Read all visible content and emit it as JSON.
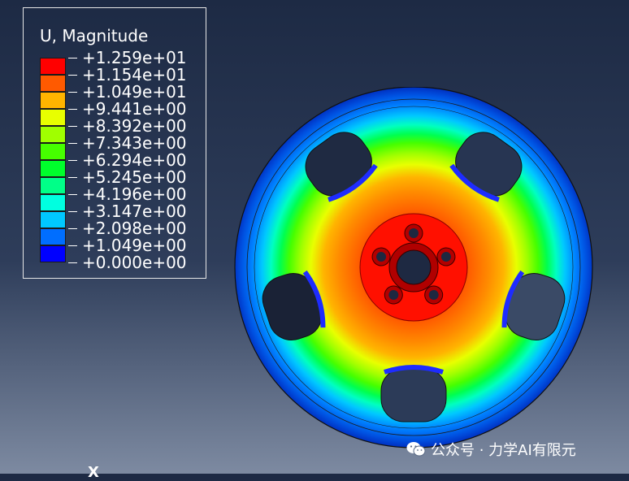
{
  "legend": {
    "title": "U, Magnitude",
    "entries": [
      {
        "label": "+1.259e+01",
        "color": "#ff0000"
      },
      {
        "label": "+1.154e+01",
        "color": "#ff5a00"
      },
      {
        "label": "+1.049e+01",
        "color": "#ffb400"
      },
      {
        "label": "+9.441e+00",
        "color": "#e8ff00"
      },
      {
        "label": "+8.392e+00",
        "color": "#a0ff00"
      },
      {
        "label": "+7.343e+00",
        "color": "#46ff00"
      },
      {
        "label": "+6.294e+00",
        "color": "#00ff2c"
      },
      {
        "label": "+5.245e+00",
        "color": "#00ff88"
      },
      {
        "label": "+4.196e+00",
        "color": "#00ffe0"
      },
      {
        "label": "+3.147e+00",
        "color": "#00c8ff"
      },
      {
        "label": "+2.098e+00",
        "color": "#006eff"
      },
      {
        "label": "+1.049e+00",
        "color": "#0000ff"
      },
      {
        "label": "+0.000e+00",
        "color": ""
      }
    ]
  },
  "watermark": {
    "text": "公众号 · 力学AI有限元",
    "icon": "wechat-icon"
  },
  "triad": {
    "x_label": "X"
  }
}
